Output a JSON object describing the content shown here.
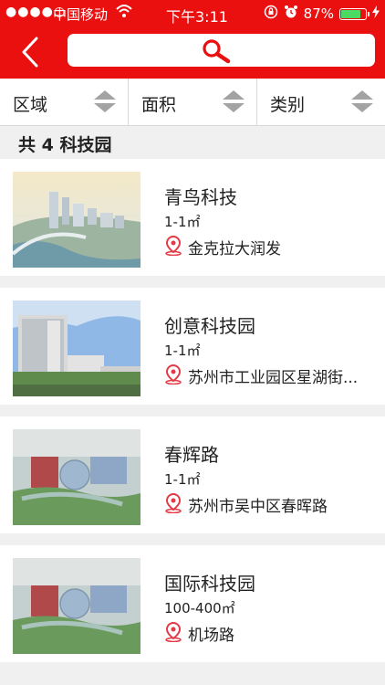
{
  "status_bar": {
    "signal": "●●●●○",
    "carrier": "中国移动",
    "time": "下午3:11",
    "battery": "87%",
    "battery_level": 0.87
  },
  "header": {
    "back_icon": "chevron-left-icon",
    "search_icon": "search-icon"
  },
  "filters": [
    {
      "label": "区域"
    },
    {
      "label": "面积"
    },
    {
      "label": "类别"
    }
  ],
  "result_count": "共 4 科技园",
  "parks": [
    {
      "name": "青鸟科技",
      "area": "1-1㎡",
      "location": "金克拉大润发"
    },
    {
      "name": "创意科技园",
      "area": "1-1㎡",
      "location": "苏州市工业园区星湖街..."
    },
    {
      "name": "春辉路",
      "area": "1-1㎡",
      "location": "苏州市吴中区春晖路"
    },
    {
      "name": "国际科技园",
      "area": "100-400㎡",
      "location": "机场路"
    }
  ],
  "colors": {
    "brand_red": "#ea1010",
    "pin_red": "#e53945"
  }
}
